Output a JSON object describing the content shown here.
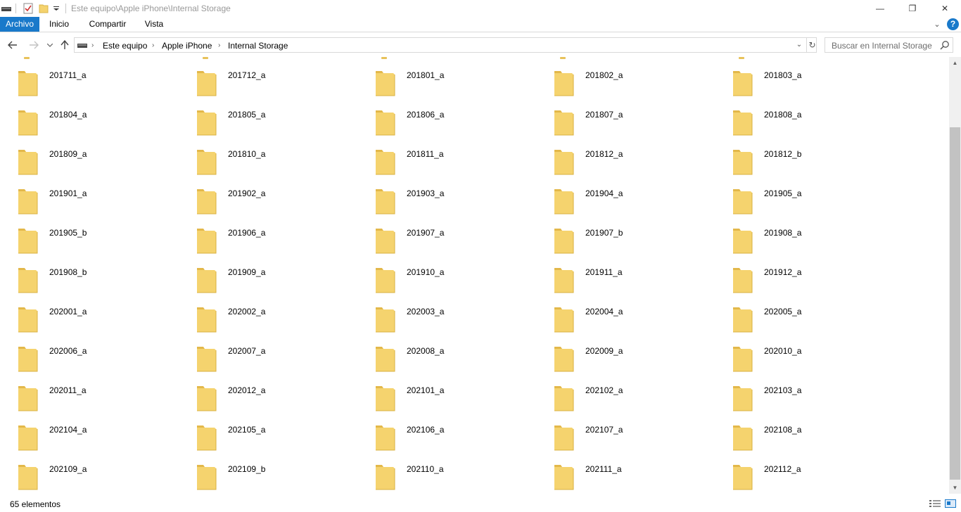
{
  "window": {
    "title": "Este equipo\\Apple iPhone\\Internal Storage",
    "controls": {
      "minimize": "—",
      "maximize": "❐",
      "close": "✕"
    }
  },
  "ribbon": {
    "tabs": [
      "Archivo",
      "Inicio",
      "Compartir",
      "Vista"
    ],
    "active_tab": "Archivo",
    "accent_color": "#1979ca",
    "help_label": "?"
  },
  "navigation": {
    "breadcrumbs": [
      "Este equipo",
      "Apple iPhone",
      "Internal Storage"
    ],
    "search_placeholder": "Buscar en Internal Storage"
  },
  "folders": [
    [
      "201711_a",
      "201712_a",
      "201801_a",
      "201802_a",
      "201803_a"
    ],
    [
      "201804_a",
      "201805_a",
      "201806_a",
      "201807_a",
      "201808_a"
    ],
    [
      "201809_a",
      "201810_a",
      "201811_a",
      "201812_a",
      "201812_b"
    ],
    [
      "201901_a",
      "201902_a",
      "201903_a",
      "201904_a",
      "201905_a"
    ],
    [
      "201905_b",
      "201906_a",
      "201907_a",
      "201907_b",
      "201908_a"
    ],
    [
      "201908_b",
      "201909_a",
      "201910_a",
      "201911_a",
      "201912_a"
    ],
    [
      "202001_a",
      "202002_a",
      "202003_a",
      "202004_a",
      "202005_a"
    ],
    [
      "202006_a",
      "202007_a",
      "202008_a",
      "202009_a",
      "202010_a"
    ],
    [
      "202011_a",
      "202012_a",
      "202101_a",
      "202102_a",
      "202103_a"
    ],
    [
      "202104_a",
      "202105_a",
      "202106_a",
      "202107_a",
      "202108_a"
    ],
    [
      "202109_a",
      "202109_b",
      "202110_a",
      "202111_a",
      "202112_a"
    ]
  ],
  "folder_icon": "folder-icon",
  "folder_color": "#f5d36e",
  "status": {
    "item_count": "65 elementos"
  }
}
